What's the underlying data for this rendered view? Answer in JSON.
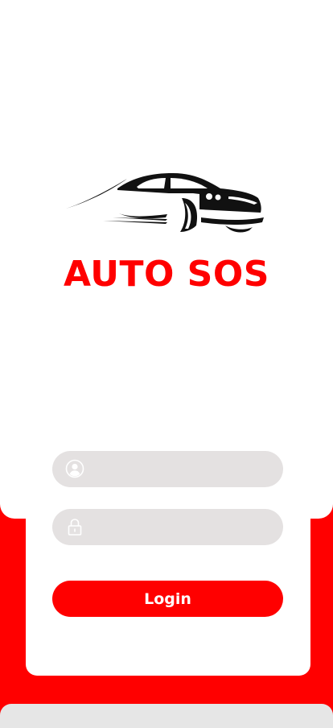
{
  "brand": {
    "title": "AUTO SOS",
    "logo_icon": "car-icon"
  },
  "login_form": {
    "username": {
      "value": "",
      "placeholder": "",
      "icon": "user-icon"
    },
    "password": {
      "value": "",
      "placeholder": "",
      "icon": "lock-icon"
    },
    "login_label": "Login"
  },
  "colors": {
    "accent": "#ff0000",
    "field_bg": "#e4e1e1",
    "card_bg": "#ffffff",
    "bottom_bar": "#e6e6e6"
  }
}
